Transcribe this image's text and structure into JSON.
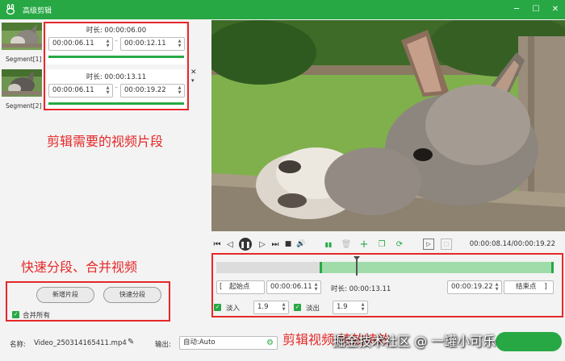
{
  "window": {
    "title": "高级剪辑"
  },
  "segments": [
    {
      "label": "Segment[1]",
      "duration_label": "时长: 00:00:06.00",
      "start": "00:00:06.11",
      "end": "00:00:12.11"
    },
    {
      "label": "Segment[2]",
      "duration_label": "时长: 00:00:13.11",
      "start": "00:00:06.11",
      "end": "00:00:19.22"
    }
  ],
  "annotations": {
    "segments": "剪辑需要的视频片段",
    "split_merge": "快速分段、合并视频",
    "effects": "剪辑视频 特效特效"
  },
  "left_actions": {
    "add_segment": "新增片段",
    "quick_split": "快速分段",
    "merge_all": "合并所有"
  },
  "player": {
    "timecode": "00:00:08.14/00:00:19.22"
  },
  "trim": {
    "start_btn": "起始点",
    "start_time": "00:00:06.11",
    "duration": "时长: 00:00:13.11",
    "end_time": "00:00:19.22",
    "end_btn": "结束点",
    "fade_in_label": "淡入",
    "fade_in_value": "1.9",
    "fade_out_label": "淡出",
    "fade_out_value": "1.9"
  },
  "bottom": {
    "name_label": "名称:",
    "name_value": "Video_250314165411.mp4",
    "output_label": "输出:",
    "output_value": "自动:Auto"
  },
  "watermark": "掘金技术社区 @ 一罐小可乐",
  "colors": {
    "accent": "#27a845",
    "annotation": "#e62828"
  }
}
